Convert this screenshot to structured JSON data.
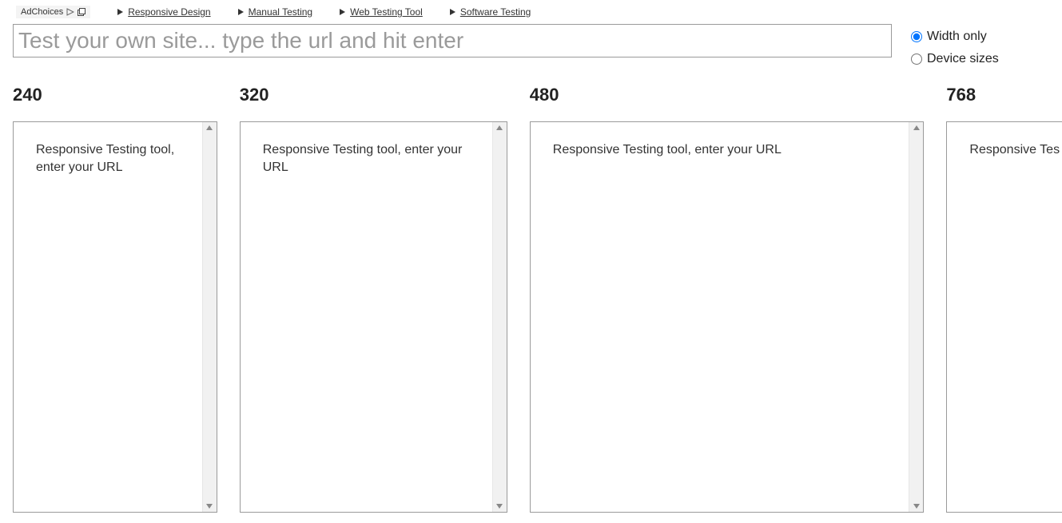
{
  "adbar": {
    "adchoices_label": "AdChoices",
    "links": [
      "Responsive Design",
      "Manual Testing",
      "Web Testing Tool",
      "Software Testing"
    ]
  },
  "url_input": {
    "placeholder": "Test your own site... type the url and hit enter",
    "value": ""
  },
  "mode_radio": {
    "options": [
      {
        "label": "Width only",
        "value": "width",
        "checked": true
      },
      {
        "label": "Device sizes",
        "value": "device",
        "checked": false
      }
    ]
  },
  "frames": [
    {
      "width_label": "240",
      "content": "Responsive Testing tool, enter your URL"
    },
    {
      "width_label": "320",
      "content": "Responsive Testing tool, enter your URL"
    },
    {
      "width_label": "480",
      "content": "Responsive Testing tool, enter your URL"
    },
    {
      "width_label": "768",
      "content": "Responsive Tes"
    }
  ]
}
